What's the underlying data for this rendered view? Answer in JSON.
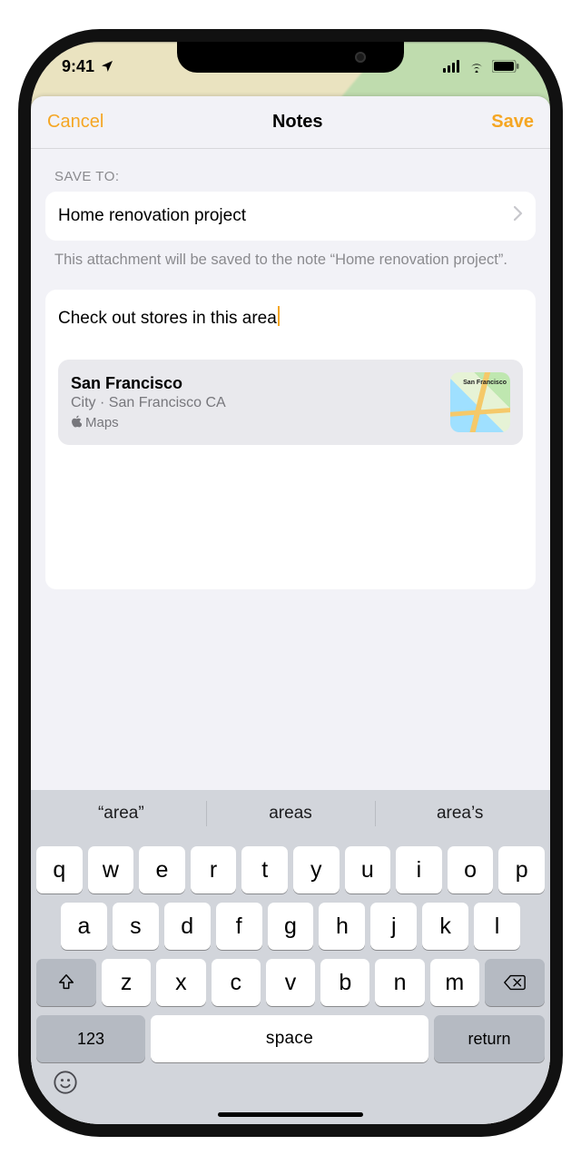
{
  "status": {
    "time": "9:41"
  },
  "nav": {
    "cancel": "Cancel",
    "title": "Notes",
    "save": "Save"
  },
  "section_label": "SAVE TO:",
  "picker": {
    "value": "Home renovation project"
  },
  "helper": "This attachment will be saved to the note “Home renovation project”.",
  "note": {
    "text": "Check out stores in this area"
  },
  "attachment": {
    "title": "San Francisco",
    "subtitle": "City · San Francisco CA",
    "source": "Maps",
    "thumb_label": "San Francisco"
  },
  "keyboard": {
    "predictions": [
      "“area”",
      "areas",
      "area’s"
    ],
    "row1": [
      "q",
      "w",
      "e",
      "r",
      "t",
      "y",
      "u",
      "i",
      "o",
      "p"
    ],
    "row2": [
      "a",
      "s",
      "d",
      "f",
      "g",
      "h",
      "j",
      "k",
      "l"
    ],
    "row3": [
      "z",
      "x",
      "c",
      "v",
      "b",
      "n",
      "m"
    ],
    "num": "123",
    "space": "space",
    "return": "return"
  }
}
